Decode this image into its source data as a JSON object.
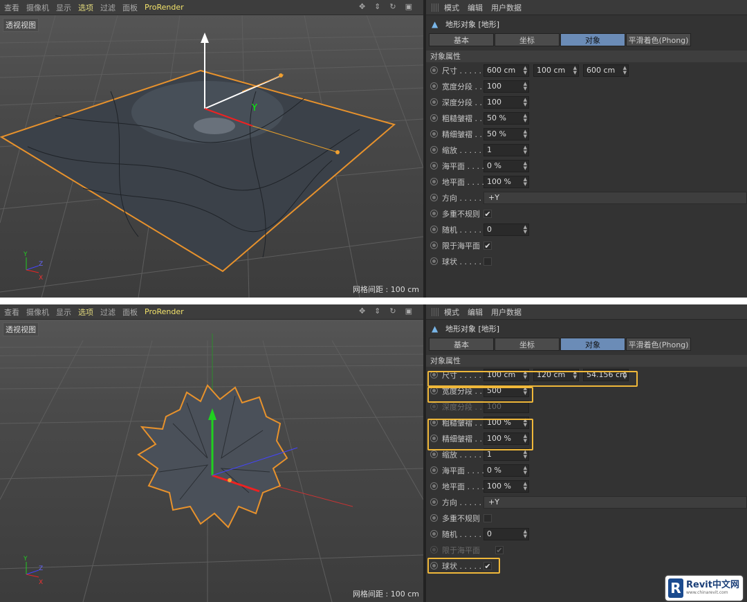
{
  "viewport_menu": {
    "items": [
      "查看",
      "摄像机",
      "显示",
      "选项",
      "过滤",
      "面板",
      "ProRender"
    ],
    "active": "选项"
  },
  "viewport": {
    "label": "透视视图",
    "grid_info": "网格间距 : 100 cm",
    "axis_labels": {
      "y": "Y",
      "z": "Z",
      "x": "X"
    }
  },
  "panel_menu": {
    "items": [
      "模式",
      "编辑",
      "用户数据"
    ]
  },
  "panel_title": "地形对象 [地形]",
  "tabs": [
    "基本",
    "坐标",
    "对象",
    "平滑着色(Phong)"
  ],
  "selected_tab": "对象",
  "section_title": "对象属性",
  "shot1": {
    "size": {
      "label": "尺寸 . . . . .",
      "x": "600 cm",
      "y": "100 cm",
      "z": "600 cm"
    },
    "width_seg": {
      "label": "宽度分段 . .",
      "value": "100"
    },
    "depth_seg": {
      "label": "深度分段 . .",
      "value": "100"
    },
    "coarse": {
      "label": "粗糙皱褶 . .",
      "value": "50 %"
    },
    "fine": {
      "label": "精细皱褶 . .",
      "value": "50 %"
    },
    "scale": {
      "label": "缩放 . . . . .",
      "value": "1"
    },
    "sea_level": {
      "label": "海平面 . . . .",
      "value": "0 %"
    },
    "plane_level": {
      "label": "地平面 . . . .",
      "value": "100 %"
    },
    "direction": {
      "label": "方向 . . . . .",
      "value": "+Y"
    },
    "multifractal": {
      "label": "多重不规则",
      "checked": "✔"
    },
    "random": {
      "label": "随机 . . . . .",
      "value": "0"
    },
    "limit_sea": {
      "label": "限于海平面",
      "checked": "✔"
    },
    "sphere": {
      "label": "球状 . . . . .",
      "checked": ""
    }
  },
  "shot2": {
    "size": {
      "label": "尺寸 . . . . .",
      "x": "100 cm",
      "y": "120 cm",
      "z": "54.156 cm"
    },
    "width_seg": {
      "label": "宽度分段 . .",
      "value": "500"
    },
    "depth_seg": {
      "label": "深度分段 . .",
      "value": "100"
    },
    "coarse": {
      "label": "粗糙皱褶 . .",
      "value": "100 %"
    },
    "fine": {
      "label": "精细皱褶 . .",
      "value": "100 %"
    },
    "scale": {
      "label": "缩放 . . . . .",
      "value": "1"
    },
    "sea_level": {
      "label": "海平面 . . . .",
      "value": "0 %"
    },
    "plane_level": {
      "label": "地平面 . . . .",
      "value": "100 %"
    },
    "direction": {
      "label": "方向 . . . . .",
      "value": "+Y"
    },
    "multifractal": {
      "label": "多重不规则",
      "checked": ""
    },
    "random": {
      "label": "随机 . . . . .",
      "value": "0"
    },
    "limit_sea": {
      "label": "限于海平面",
      "checked": "✔"
    },
    "sphere": {
      "label": "球状 . . . . .",
      "checked": "✔"
    }
  },
  "colors": {
    "highlight": "#f0b83a",
    "selected_tab": "#6b8cb7",
    "prorender": "#f2e26a",
    "selection_outline": "#e8922c"
  },
  "watermark": {
    "logo": "R",
    "title": "Revit中文网",
    "url": "www.chinarevit.com"
  }
}
